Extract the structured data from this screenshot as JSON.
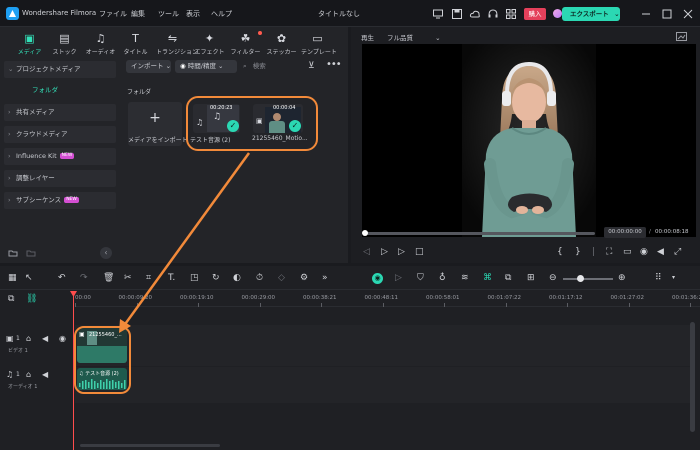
{
  "app": {
    "name": "Wondershare Filmora",
    "title": "タイトルなし"
  },
  "menu": [
    "ファイル",
    "編集",
    "ツール",
    "表示",
    "ヘルプ"
  ],
  "header": {
    "buy_label": "購入",
    "export_label": "エクスポート"
  },
  "toolbar": [
    "メディア",
    "ストック",
    "オーディオ",
    "タイトル",
    "トランジション",
    "エフェクト",
    "フィルター",
    "ステッカー",
    "テンプレート"
  ],
  "sidebar": {
    "items": [
      {
        "label": "プロジェクトメディア"
      },
      {
        "label": "フォルダ"
      },
      {
        "label": "共有メディア"
      },
      {
        "label": "クラウドメディア"
      },
      {
        "label": "Influence Kit",
        "badge": "NEW"
      },
      {
        "label": "調整レイヤー"
      },
      {
        "label": "サブシーケンス",
        "badge": "NEW"
      }
    ]
  },
  "media": {
    "import_label": "インポート",
    "filter_label": "時間/精度",
    "search_placeholder": "検索",
    "folder_label": "フォルダ",
    "import_tile_label": "メディアをインポート",
    "items": [
      {
        "duration": "00:20:23",
        "name": "テスト音源 (2)"
      },
      {
        "duration": "00:00:04",
        "name": "21255460_Motio..."
      }
    ]
  },
  "player": {
    "tab_label": "再生",
    "quality": "フル品質",
    "current_time": "00:00:00:00",
    "total_time": "00:00:08:18",
    "progress": 0
  },
  "timeline": {
    "ruler": [
      "00:00",
      "00:00:09:20",
      "00:00:19:10",
      "00:00:29:00",
      "00:00:38:21",
      "00:00:48:11",
      "00:00:58:01",
      "00:01:07:22",
      "00:01:17:12",
      "00:01:27:02",
      "00:01:36:22"
    ],
    "tracks": [
      {
        "label": "ビデオ 1"
      },
      {
        "label": "オーディオ 1"
      }
    ],
    "clips": {
      "video": "21255460_...",
      "audio": "テスト音源 (2)"
    }
  },
  "colors": {
    "accent": "#2bd8b3",
    "highlight": "#f28a3a",
    "playhead": "#ff4d4d"
  }
}
